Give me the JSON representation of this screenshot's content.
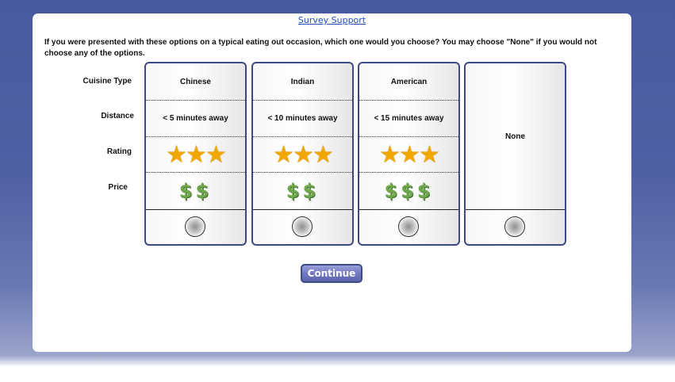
{
  "header": {
    "support_link": "Survey Support"
  },
  "question": "If you were presented with these options on a typical eating out occasion, which one would you choose? You may choose \"None\" if you would not choose any of the options.",
  "row_labels": {
    "cuisine": "Cuisine Type",
    "distance": "Distance",
    "rating": "Rating",
    "price": "Price"
  },
  "options": [
    {
      "cuisine": "Chinese",
      "distance": "< 5 minutes away",
      "rating_stars": 3,
      "rating_display": "★★★",
      "price_level": 2,
      "price_display": "$$"
    },
    {
      "cuisine": "Indian",
      "distance": "< 10 minutes away",
      "rating_stars": 3,
      "rating_display": "★★★",
      "price_level": 2,
      "price_display": "$$"
    },
    {
      "cuisine": "American",
      "distance": "< 15 minutes away",
      "rating_stars": 3,
      "rating_display": "★★★",
      "price_level": 3,
      "price_display": "$$$"
    }
  ],
  "none_option": {
    "label": "None"
  },
  "continue_label": "Continue",
  "colors": {
    "star": "#f0a800",
    "dollar": "#6fa84c",
    "accent": "#3d4a86",
    "link": "#1f4fb8"
  }
}
